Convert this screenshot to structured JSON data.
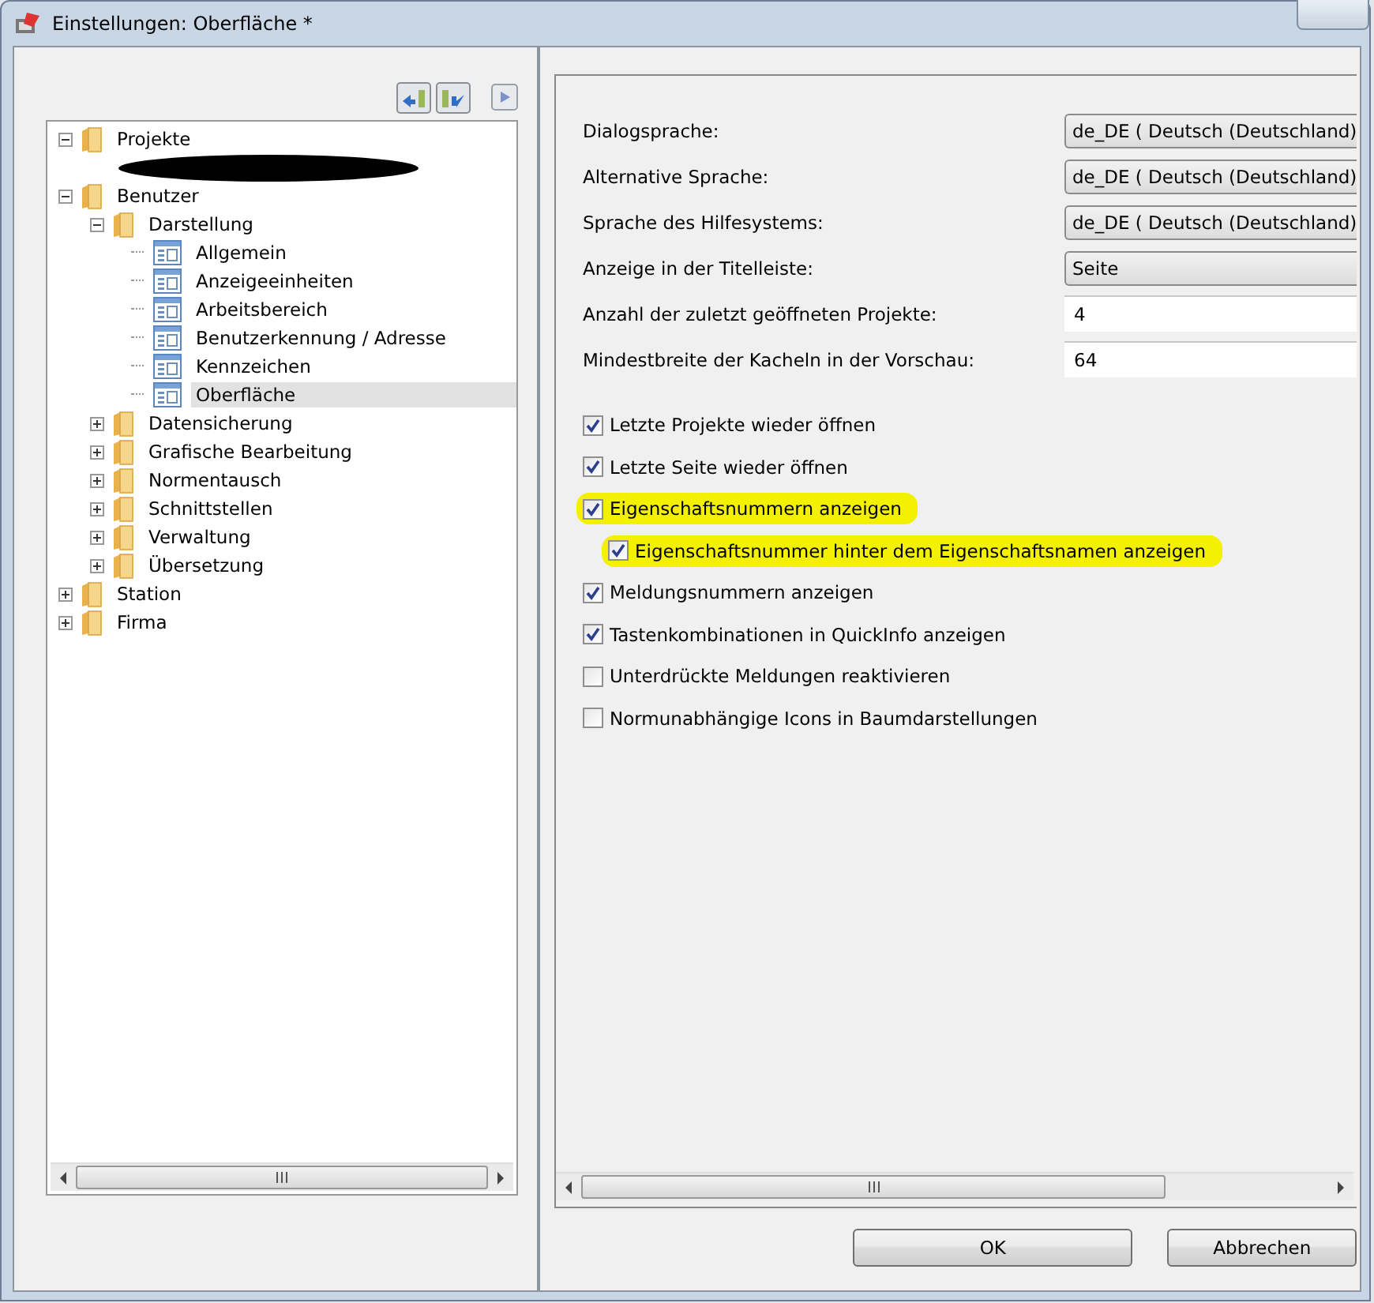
{
  "window": {
    "title": "Einstellungen: Oberfläche *"
  },
  "tree": [
    {
      "label": "Projekte",
      "kind": "folder",
      "expanded": true,
      "selected": false,
      "children": [
        {
          "kind": "redacted"
        }
      ]
    },
    {
      "label": "Benutzer",
      "kind": "folder",
      "expanded": true,
      "selected": false,
      "children": [
        {
          "label": "Darstellung",
          "kind": "folder",
          "expanded": true,
          "selected": false,
          "children": [
            {
              "label": "Allgemein",
              "kind": "page",
              "selected": false
            },
            {
              "label": "Anzeigeeinheiten",
              "kind": "page",
              "selected": false
            },
            {
              "label": "Arbeitsbereich",
              "kind": "page",
              "selected": false
            },
            {
              "label": "Benutzerkennung / Adresse",
              "kind": "page",
              "selected": false
            },
            {
              "label": "Kennzeichen",
              "kind": "page",
              "selected": false
            },
            {
              "label": "Oberfläche",
              "kind": "page",
              "selected": true
            }
          ]
        },
        {
          "label": "Datensicherung",
          "kind": "folder",
          "expanded": false,
          "selected": false
        },
        {
          "label": "Grafische Bearbeitung",
          "kind": "folder",
          "expanded": false,
          "selected": false
        },
        {
          "label": "Normentausch",
          "kind": "folder",
          "expanded": false,
          "selected": false
        },
        {
          "label": "Schnittstellen",
          "kind": "folder",
          "expanded": false,
          "selected": false
        },
        {
          "label": "Verwaltung",
          "kind": "folder",
          "expanded": false,
          "selected": false
        },
        {
          "label": "Übersetzung",
          "kind": "folder",
          "expanded": false,
          "selected": false
        }
      ]
    },
    {
      "label": "Station",
      "kind": "folder",
      "expanded": false,
      "selected": false
    },
    {
      "label": "Firma",
      "kind": "folder",
      "expanded": false,
      "selected": false
    }
  ],
  "fields": [
    {
      "label": "Dialogsprache:",
      "kind": "combo",
      "value": "de_DE ( Deutsch (Deutschland)"
    },
    {
      "label": "Alternative Sprache:",
      "kind": "combo",
      "value": "de_DE ( Deutsch (Deutschland)"
    },
    {
      "label": "Sprache des Hilfesystems:",
      "kind": "combo",
      "value": "de_DE ( Deutsch (Deutschland)"
    },
    {
      "label": "Anzeige in der Titelleiste:",
      "kind": "combo",
      "value": "Seite"
    },
    {
      "label": "Anzahl der zuletzt geöffneten Projekte:",
      "kind": "text",
      "value": "4"
    },
    {
      "label": "Mindestbreite der Kacheln in der Vorschau:",
      "kind": "text",
      "value": "64"
    }
  ],
  "options": [
    {
      "label": "Letzte Projekte wieder öffnen",
      "checked": true,
      "highlighted": false
    },
    {
      "label": "Letzte Seite wieder öffnen",
      "checked": true,
      "highlighted": false
    },
    {
      "label": "Eigenschaftsnummern anzeigen",
      "checked": true,
      "highlighted": true,
      "children": [
        {
          "label": "Eigenschaftsnummer hinter dem Eigenschaftsnamen anzeigen",
          "checked": true,
          "highlighted": true
        }
      ]
    },
    {
      "label": "Meldungsnummern anzeigen",
      "checked": true,
      "highlighted": false
    },
    {
      "label": "Tastenkombinationen in QuickInfo anzeigen",
      "checked": true,
      "highlighted": false
    },
    {
      "label": "Unterdrückte Meldungen reaktivieren",
      "checked": false,
      "highlighted": false
    },
    {
      "label": "Normunabhängige Icons in Baumdarstellungen",
      "checked": false,
      "highlighted": false
    }
  ],
  "buttons": [
    {
      "label": "OK"
    },
    {
      "label": "Abbrechen"
    }
  ]
}
